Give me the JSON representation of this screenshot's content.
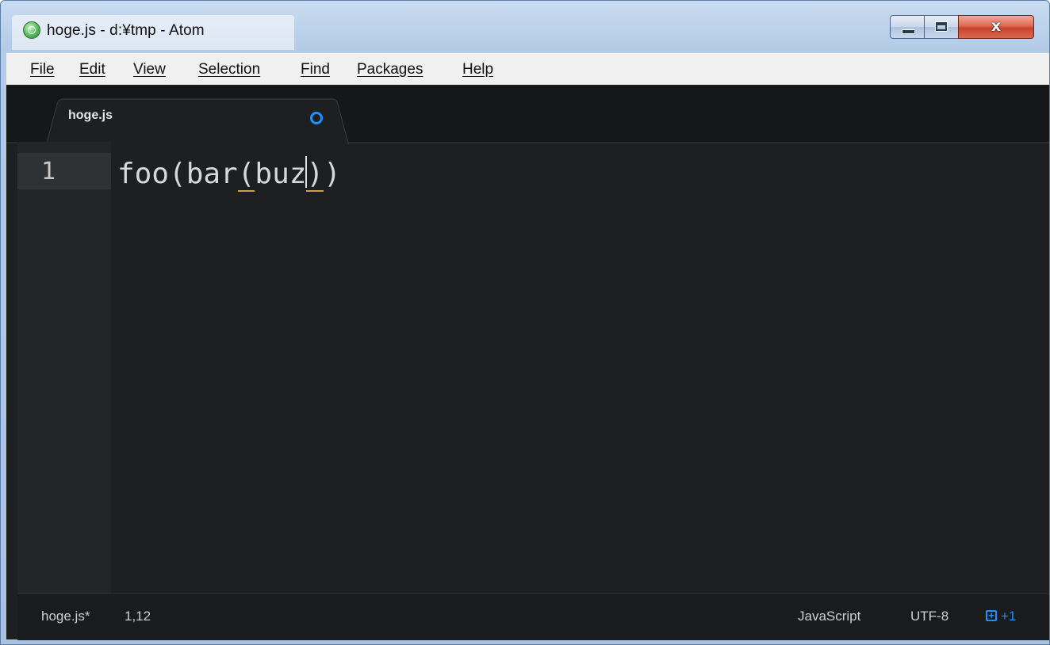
{
  "window": {
    "title": "hoge.js - d:¥tmp - Atom",
    "close_glyph": "x"
  },
  "menubar": {
    "items": [
      "File",
      "Edit",
      "View",
      "Selection",
      "Find",
      "Packages",
      "Help"
    ]
  },
  "tabs": [
    {
      "label": "hoge.js",
      "modified": true
    }
  ],
  "editor": {
    "line_number": "1",
    "code_before_cursor_prefix": "foo(bar",
    "code_open_paren": "(",
    "code_inner": "buz",
    "code_close_paren": ")",
    "code_after": ")",
    "language_color_accent": "#c8a24b"
  },
  "statusbar": {
    "file": "hoge.js*",
    "cursor_position": "1,12",
    "grammar": "JavaScript",
    "encoding": "UTF-8",
    "git_icon_glyph": "+",
    "git_count": "+1",
    "accent_color": "#1e90ff"
  }
}
